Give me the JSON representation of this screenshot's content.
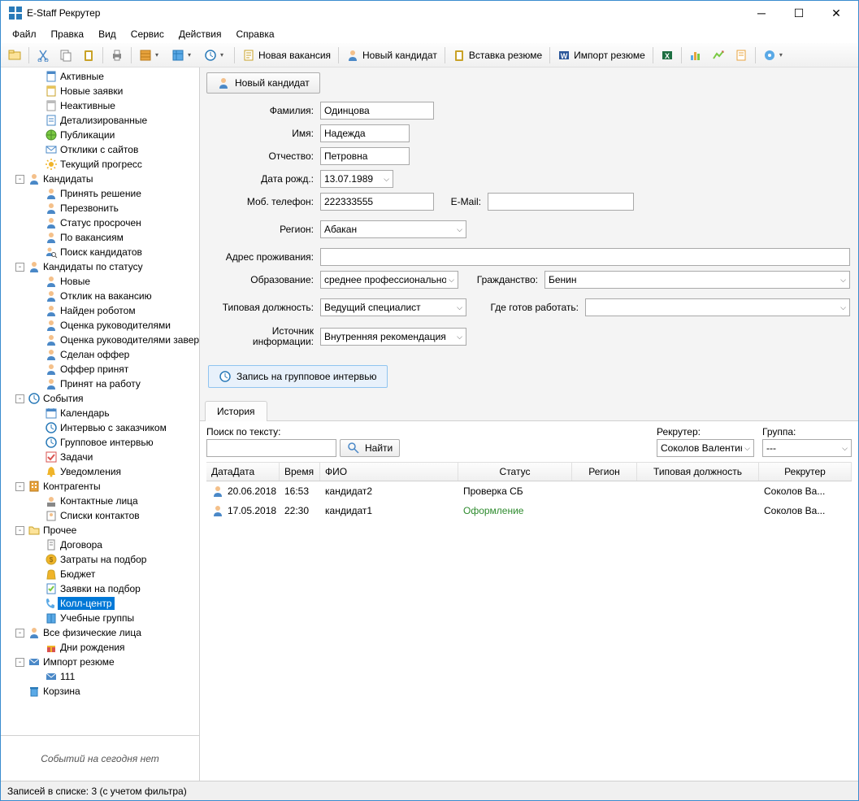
{
  "window": {
    "title": "E-Staff Рекрутер"
  },
  "menu": [
    "Файл",
    "Правка",
    "Вид",
    "Сервис",
    "Действия",
    "Справка"
  ],
  "toolbar": {
    "items": [
      {
        "icon": "open",
        "sep": 0
      },
      {
        "icon": "cut",
        "sep": 0
      },
      {
        "icon": "copy",
        "sep": 0
      },
      {
        "icon": "paste",
        "sep": 0
      }
    ],
    "new_vacancy": "Новая вакансия",
    "new_candidate": "Новый кандидат",
    "insert_resume": "Вставка резюме",
    "import_resume": "Импорт резюме"
  },
  "tree": [
    {
      "ind": 3,
      "icon": "doc-blue",
      "label": "Активные"
    },
    {
      "ind": 3,
      "icon": "doc-yellow",
      "label": "Новые заявки"
    },
    {
      "ind": 3,
      "icon": "doc-grey",
      "label": "Неактивные"
    },
    {
      "ind": 3,
      "icon": "doc-list",
      "label": "Детализированные"
    },
    {
      "ind": 3,
      "icon": "globe",
      "label": "Публикации"
    },
    {
      "ind": 3,
      "icon": "msg",
      "label": "Отклики с сайтов"
    },
    {
      "ind": 3,
      "icon": "sun",
      "label": "Текущий прогресс"
    },
    {
      "ind": 1,
      "exp": "-",
      "icon": "person",
      "label": "Кандидаты"
    },
    {
      "ind": 3,
      "icon": "person",
      "label": "Принять решение"
    },
    {
      "ind": 3,
      "icon": "person",
      "label": "Перезвонить"
    },
    {
      "ind": 3,
      "icon": "person",
      "label": "Статус просрочен"
    },
    {
      "ind": 3,
      "icon": "person",
      "label": "По вакансиям"
    },
    {
      "ind": 3,
      "icon": "person-search",
      "label": "Поиск кандидатов"
    },
    {
      "ind": 1,
      "exp": "-",
      "icon": "person",
      "label": "Кандидаты по статусу"
    },
    {
      "ind": 3,
      "icon": "person",
      "label": "Новые"
    },
    {
      "ind": 3,
      "icon": "person",
      "label": "Отклик на вакансию"
    },
    {
      "ind": 3,
      "icon": "person",
      "label": "Найден роботом"
    },
    {
      "ind": 3,
      "icon": "person",
      "label": "Оценка руководителями"
    },
    {
      "ind": 3,
      "icon": "person",
      "label": "Оценка руководителями завершена"
    },
    {
      "ind": 3,
      "icon": "person",
      "label": "Сделан оффер"
    },
    {
      "ind": 3,
      "icon": "person",
      "label": "Оффер принят"
    },
    {
      "ind": 3,
      "icon": "person",
      "label": "Принят на работу"
    },
    {
      "ind": 1,
      "exp": "-",
      "icon": "clock",
      "label": "События"
    },
    {
      "ind": 3,
      "icon": "calendar",
      "label": "Календарь"
    },
    {
      "ind": 3,
      "icon": "clock",
      "label": "Интервью с заказчиком"
    },
    {
      "ind": 3,
      "icon": "clock",
      "label": "Групповое интервью"
    },
    {
      "ind": 3,
      "icon": "check",
      "label": "Задачи"
    },
    {
      "ind": 3,
      "icon": "bell",
      "label": "Уведомления"
    },
    {
      "ind": 1,
      "exp": "-",
      "icon": "building",
      "label": "Контрагенты"
    },
    {
      "ind": 3,
      "icon": "contact",
      "label": "Контактные лица"
    },
    {
      "ind": 3,
      "icon": "contacts",
      "label": "Списки контактов"
    },
    {
      "ind": 1,
      "exp": "-",
      "icon": "folder",
      "label": "Прочее"
    },
    {
      "ind": 3,
      "icon": "doc",
      "label": "Договора"
    },
    {
      "ind": 3,
      "icon": "money",
      "label": "Затраты на подбор"
    },
    {
      "ind": 3,
      "icon": "bag",
      "label": "Бюджет"
    },
    {
      "ind": 3,
      "icon": "doc-check",
      "label": "Заявки на подбор"
    },
    {
      "ind": 3,
      "icon": "phone",
      "label": "Колл-центр",
      "selected": true
    },
    {
      "ind": 3,
      "icon": "book",
      "label": "Учебные группы"
    },
    {
      "ind": 1,
      "exp": "-",
      "icon": "person",
      "label": "Все физические лица"
    },
    {
      "ind": 3,
      "icon": "gift",
      "label": "Дни рождения"
    },
    {
      "ind": 1,
      "exp": "-",
      "icon": "mail",
      "label": "Импорт резюме"
    },
    {
      "ind": 3,
      "icon": "mail",
      "label": "111"
    },
    {
      "ind": 1,
      "icon": "trash",
      "label": "Корзина"
    }
  ],
  "sidebar_footer": "Событий на сегодня нет",
  "content": {
    "new_candidate_btn": "Новый кандидат",
    "labels": {
      "lastname": "Фамилия:",
      "firstname": "Имя:",
      "patronymic": "Отчество:",
      "birthdate": "Дата рожд.:",
      "phone": "Моб. телефон:",
      "email": "E-Mail:",
      "region": "Регион:",
      "address": "Адрес проживания:",
      "education": "Образование:",
      "citizenship": "Гражданство:",
      "position": "Типовая должность:",
      "worklocation": "Где готов работать:",
      "source": "Источник\nинформации:"
    },
    "values": {
      "lastname": "Одинцова",
      "firstname": "Надежда",
      "patronymic": "Петровна",
      "birthdate": "13.07.1989",
      "phone": "222333555",
      "email": "",
      "region": "Абакан",
      "address": "",
      "education": "среднее профессиональное",
      "citizenship": "Бенин",
      "position": "Ведущий специалист",
      "worklocation": "",
      "source": "Внутренняя рекомендация"
    },
    "group_interview": "Запись на групповое интервью"
  },
  "history": {
    "tab": "История",
    "search_label": "Поиск по тексту:",
    "find": "Найти",
    "recruiter_label": "Рекрутер:",
    "recruiter_value": "Соколов Валентин",
    "group_label": "Группа:",
    "group_value": "---",
    "columns": [
      "Дата",
      "Время",
      "ФИО",
      "Статус",
      "Регион",
      "Типовая должность",
      "Рекрутер"
    ],
    "rows": [
      {
        "date": "20.06.2018",
        "time": "16:53",
        "fio": "кандидат2",
        "status": "Проверка СБ",
        "status_class": "",
        "region": "",
        "pos": "",
        "rec": "Соколов Ва..."
      },
      {
        "date": "17.05.2018",
        "time": "22:30",
        "fio": "кандидат1",
        "status": "Оформление",
        "status_class": "green",
        "region": "",
        "pos": "",
        "rec": "Соколов Ва..."
      }
    ]
  },
  "statusbar": "Записей в списке: 3  (с учетом фильтра)"
}
